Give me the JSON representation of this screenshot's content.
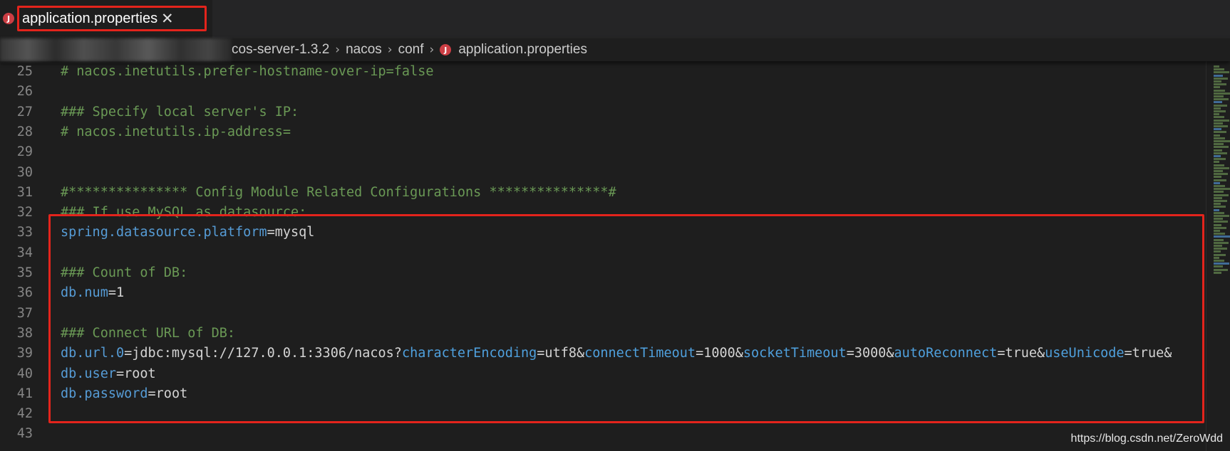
{
  "tab": {
    "icon_letter": "J",
    "filename": "application.properties",
    "close_glyph": "✕"
  },
  "breadcrumb": {
    "items": [
      "cos-server-1.3.2",
      "nacos",
      "conf",
      "application.properties"
    ],
    "separator": "›",
    "file_icon_letter": "J"
  },
  "editor": {
    "lines": [
      {
        "n": "25",
        "tokens": [
          {
            "t": "# nacos.inetutils.prefer-hostname-over-ip=false",
            "c": "cm"
          }
        ]
      },
      {
        "n": "26",
        "tokens": []
      },
      {
        "n": "27",
        "tokens": [
          {
            "t": "### Specify local server's IP:",
            "c": "cm"
          }
        ]
      },
      {
        "n": "28",
        "tokens": [
          {
            "t": "# nacos.inetutils.ip-address=",
            "c": "cm"
          }
        ]
      },
      {
        "n": "29",
        "tokens": []
      },
      {
        "n": "30",
        "tokens": []
      },
      {
        "n": "31",
        "tokens": [
          {
            "t": "#*************** Config Module Related Configurations ***************#",
            "c": "cm"
          }
        ]
      },
      {
        "n": "32",
        "tokens": [
          {
            "t": "### If use MySQL as datasource:",
            "c": "cm"
          }
        ]
      },
      {
        "n": "33",
        "tokens": [
          {
            "t": "spring.datasource.platform",
            "c": "key"
          },
          {
            "t": "=mysql",
            "c": "val"
          }
        ]
      },
      {
        "n": "34",
        "tokens": []
      },
      {
        "n": "35",
        "tokens": [
          {
            "t": "### Count of DB:",
            "c": "cm"
          }
        ]
      },
      {
        "n": "36",
        "tokens": [
          {
            "t": "db.num",
            "c": "key"
          },
          {
            "t": "=1",
            "c": "val"
          }
        ]
      },
      {
        "n": "37",
        "tokens": []
      },
      {
        "n": "38",
        "tokens": [
          {
            "t": "### Connect URL of DB:",
            "c": "cm"
          }
        ]
      },
      {
        "n": "39",
        "tokens": [
          {
            "t": "db.url.0",
            "c": "key"
          },
          {
            "t": "=jdbc:mysql://127.0.0.1:3306/nacos?",
            "c": "val"
          },
          {
            "t": "characterEncoding",
            "c": "qk"
          },
          {
            "t": "=utf8&",
            "c": "val"
          },
          {
            "t": "connectTimeout",
            "c": "qk"
          },
          {
            "t": "=1000&",
            "c": "val"
          },
          {
            "t": "socketTimeout",
            "c": "qk"
          },
          {
            "t": "=3000&",
            "c": "val"
          },
          {
            "t": "autoReconnect",
            "c": "qk"
          },
          {
            "t": "=true&",
            "c": "val"
          },
          {
            "t": "useUnicode",
            "c": "qk"
          },
          {
            "t": "=true&",
            "c": "val"
          }
        ]
      },
      {
        "n": "40",
        "tokens": [
          {
            "t": "db.user",
            "c": "key"
          },
          {
            "t": "=root",
            "c": "val"
          }
        ]
      },
      {
        "n": "41",
        "tokens": [
          {
            "t": "db.password",
            "c": "key"
          },
          {
            "t": "=root",
            "c": "val"
          }
        ]
      },
      {
        "n": "42",
        "tokens": []
      },
      {
        "n": "43",
        "tokens": []
      }
    ]
  },
  "watermark": "https://blog.csdn.net/ZeroWdd",
  "colors": {
    "highlight": "#e3241c",
    "comment": "#6a9955",
    "key": "#569cd6",
    "background": "#1e1e1e"
  }
}
